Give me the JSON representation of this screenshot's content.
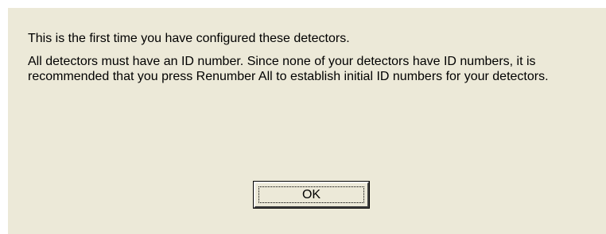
{
  "dialog": {
    "line1": "This is the first time you have configured these detectors.",
    "line2": "All detectors must have an ID number.  Since none of your detectors have ID numbers, it is recommended that you press Renumber All to establish initial ID numbers for your detectors.",
    "ok_label": "OK"
  },
  "colors": {
    "dialog_background": "#ece9d8",
    "outer_background": "#ffffff"
  }
}
